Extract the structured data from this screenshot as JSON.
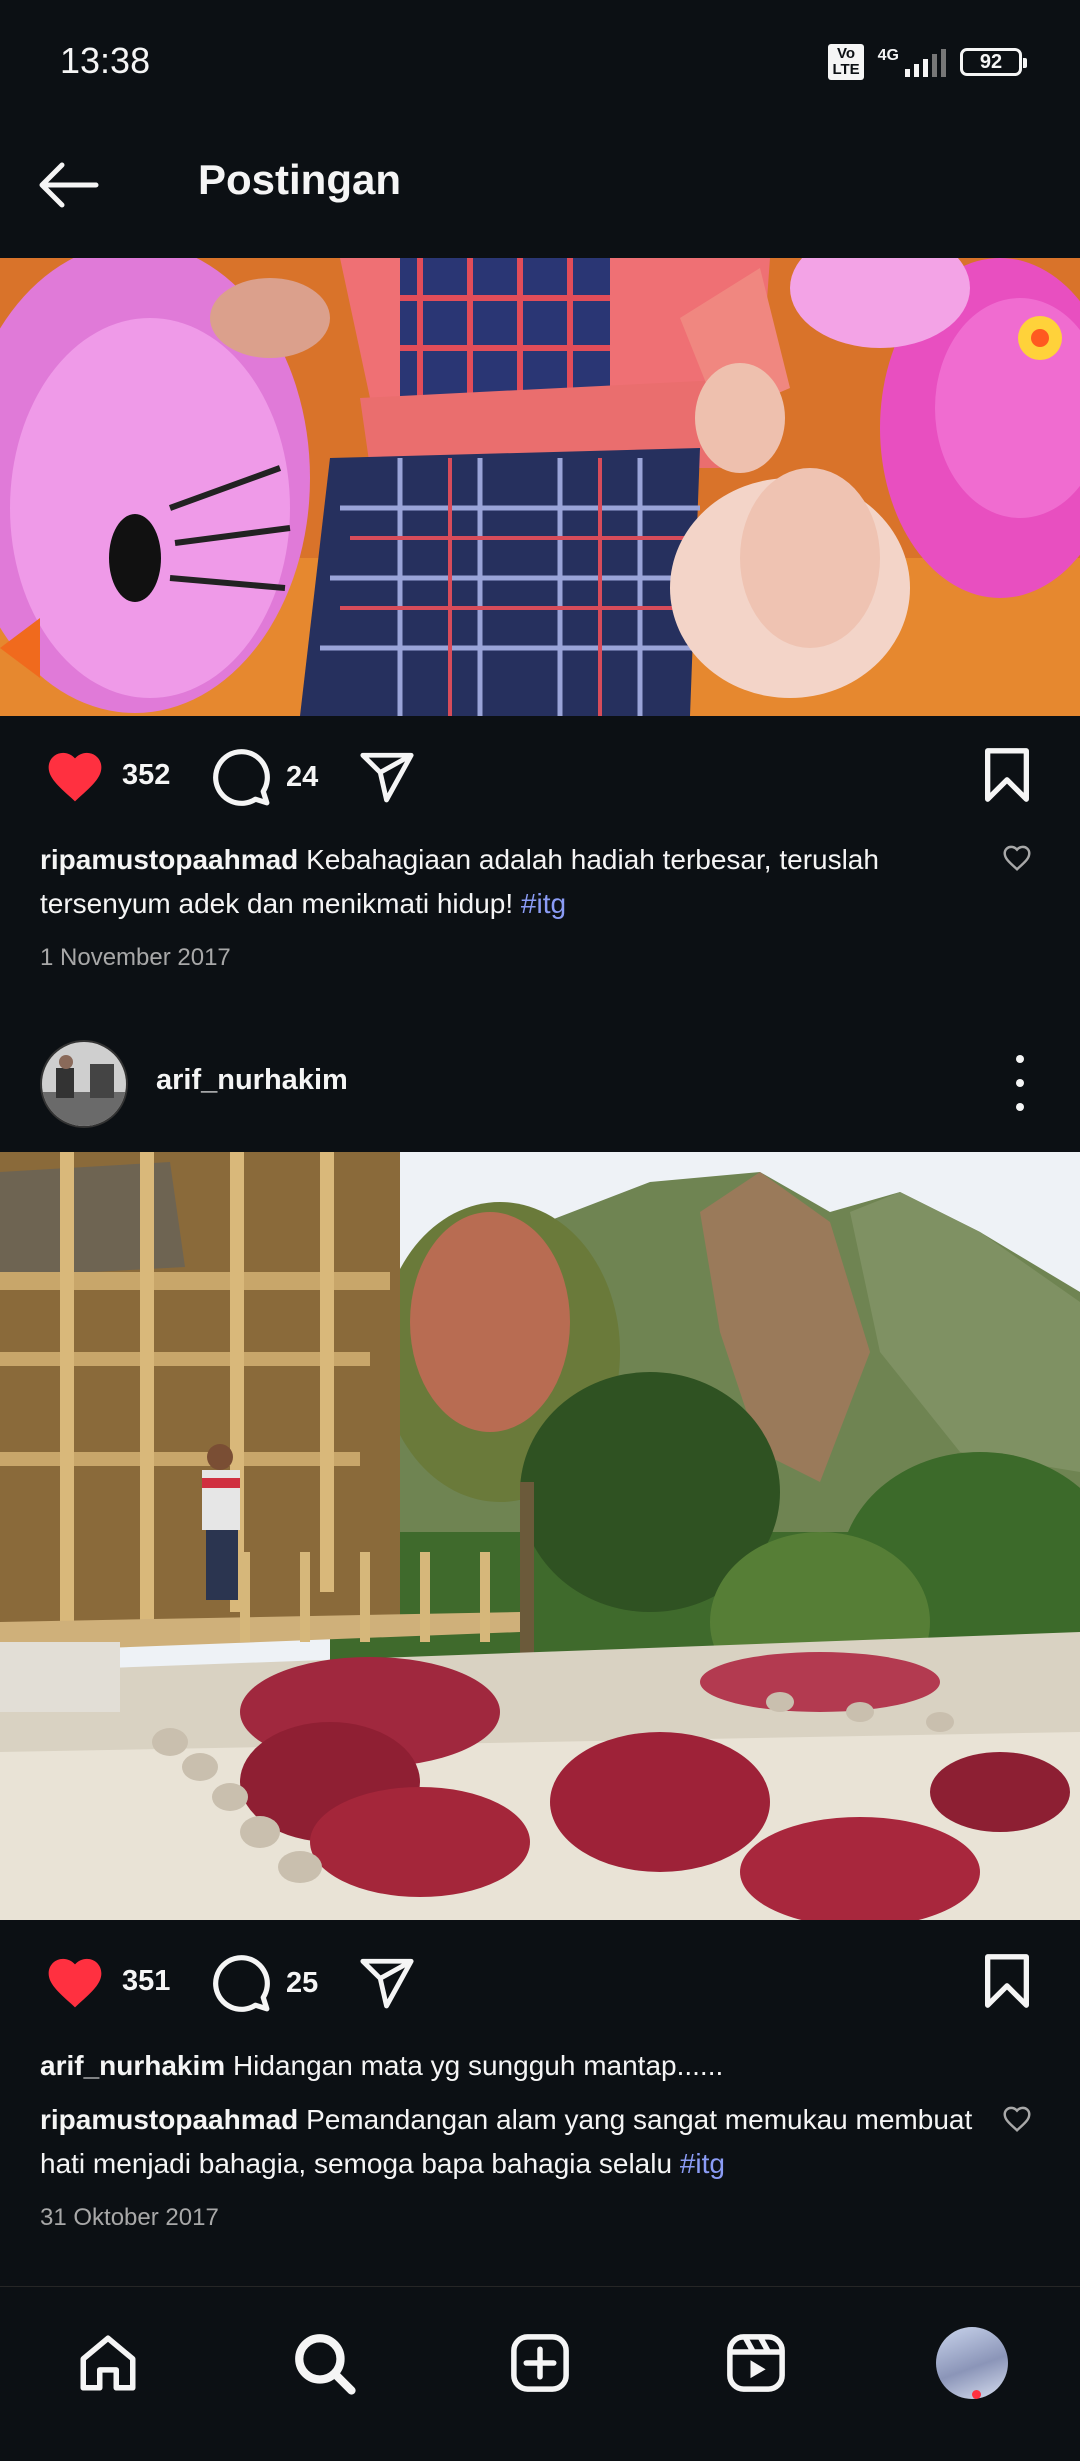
{
  "status_bar": {
    "time": "13:38",
    "volte": "Vo LTE",
    "network": "4G",
    "battery": "92"
  },
  "header": {
    "title": "Postingan",
    "back_icon": "arrow-left-icon"
  },
  "posts": [
    {
      "likes": "352",
      "comments": "24",
      "caption_user": "ripamustopaahmad",
      "caption_text": "Kebahagiaan adalah hadiah terbesar, teruslah tersenyum adek  dan menikmati hidup! ",
      "hashtag": "#itg",
      "date": "1 November 2017"
    },
    {
      "username": "arif_nurhakim",
      "likes": "351",
      "comments": "25",
      "caption_user": "arif_nurhakim",
      "caption_text": "Hidangan mata yg sungguh mantap......",
      "comment_user": "ripamustopaahmad",
      "comment_text": "Pemandangan alam yang sangat memukau membuat hati menjadi bahagia, semoga bapa bahagia selalu ",
      "comment_hashtag": "#itg",
      "date": "31 Oktober 2017"
    }
  ],
  "colors": {
    "background": "#0c1014",
    "like": "#ff3040",
    "hashtag": "#8b9cf5",
    "muted": "#a8a8a8"
  },
  "bottom_nav": [
    "home-icon",
    "search-icon",
    "create-icon",
    "reels-icon",
    "profile-avatar"
  ]
}
